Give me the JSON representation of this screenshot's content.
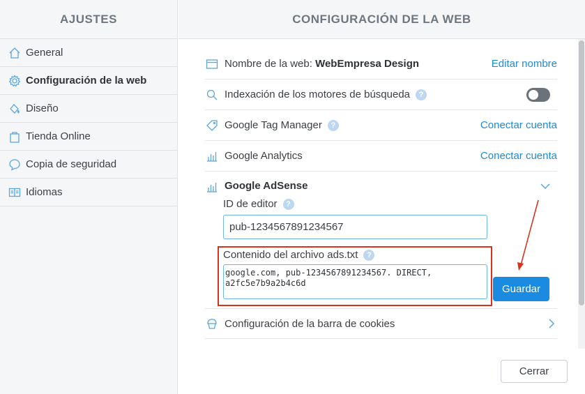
{
  "sidebar": {
    "title": "AJUSTES",
    "items": [
      {
        "label": "General",
        "icon": "home-icon"
      },
      {
        "label": "Configuración de la web",
        "icon": "gear-icon"
      },
      {
        "label": "Diseño",
        "icon": "paint-bucket-icon"
      },
      {
        "label": "Tienda Online",
        "icon": "shopping-bag-icon"
      },
      {
        "label": "Copia de seguridad",
        "icon": "chat-bubble-icon"
      },
      {
        "label": "Idiomas",
        "icon": "languages-icon"
      }
    ]
  },
  "main": {
    "title": "CONFIGURACIÓN DE LA WEB",
    "site_name_label": "Nombre de la web: ",
    "site_name_value": "WebEmpresa Design",
    "edit_name_link": "Editar nombre",
    "indexing_label": "Indexación de los motores de búsqueda",
    "indexing_enabled": false,
    "gtm_label": "Google Tag Manager",
    "gtm_link": "Conectar cuenta",
    "analytics_label": "Google Analytics",
    "analytics_link": "Conectar cuenta",
    "adsense_label": "Google AdSense",
    "editor_id_label": "ID de editor",
    "editor_id_value": "pub-1234567891234567",
    "ads_txt_label": "Contenido del archivo ads.txt",
    "ads_txt_value": "google.com, pub-1234567891234567. DIRECT,\na2fc5e7b9a2b4c6d",
    "save_button": "Guardar",
    "cookies_label": "Configuración de la barra de cookies",
    "close_button": "Cerrar",
    "help_glyph": "?"
  },
  "colors": {
    "accent": "#1a8be0",
    "link": "#1e8ad6",
    "annotation": "#d9331f"
  }
}
